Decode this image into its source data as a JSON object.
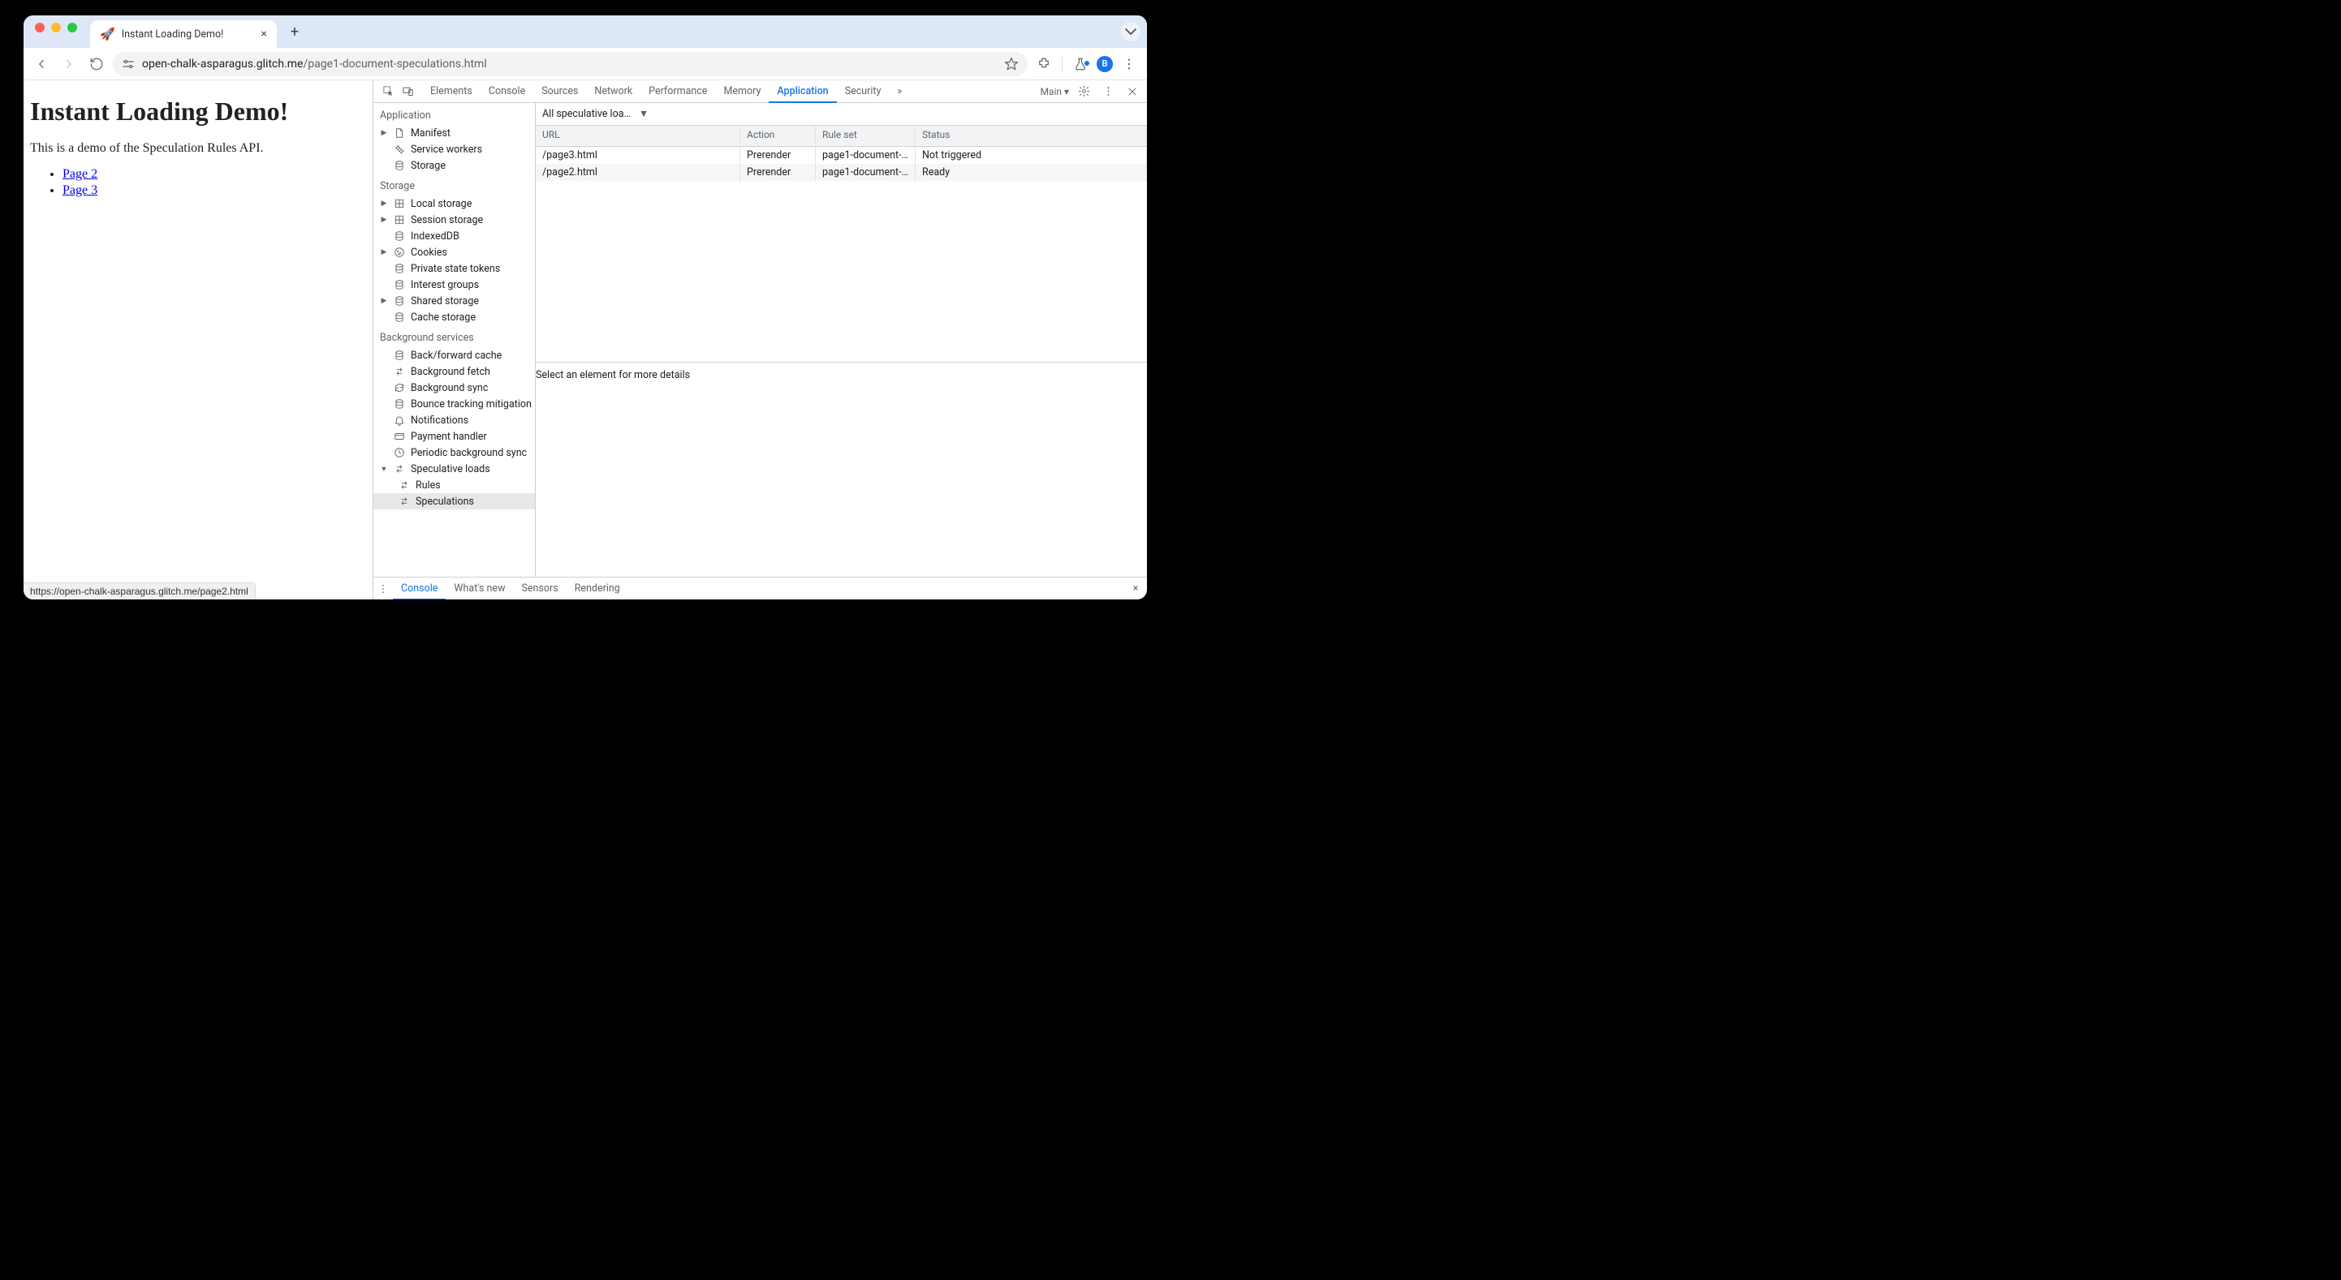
{
  "window": {
    "tab_title": "Instant Loading Demo!",
    "favicon": "🚀"
  },
  "toolbar": {
    "url_host": "open-chalk-asparagus.glitch.me",
    "url_path": "/page1-document-speculations.html",
    "avatar_letter": "B"
  },
  "page": {
    "heading": "Instant Loading Demo!",
    "intro": "This is a demo of the Speculation Rules API.",
    "links": [
      "Page 2",
      "Page 3"
    ],
    "status_url": "https://open-chalk-asparagus.glitch.me/page2.html"
  },
  "devtools": {
    "tabs": [
      "Elements",
      "Console",
      "Sources",
      "Network",
      "Performance",
      "Memory",
      "Application",
      "Security"
    ],
    "active_tab": "Application",
    "more": "»",
    "target_label": "Main",
    "sidebar": {
      "groups": [
        {
          "title": "Application",
          "items": [
            {
              "label": "Manifest",
              "icon": "file",
              "expandable": true
            },
            {
              "label": "Service workers",
              "icon": "gears"
            },
            {
              "label": "Storage",
              "icon": "db"
            }
          ]
        },
        {
          "title": "Storage",
          "items": [
            {
              "label": "Local storage",
              "icon": "grid",
              "expandable": true
            },
            {
              "label": "Session storage",
              "icon": "grid",
              "expandable": true
            },
            {
              "label": "IndexedDB",
              "icon": "db"
            },
            {
              "label": "Cookies",
              "icon": "cookie",
              "expandable": true
            },
            {
              "label": "Private state tokens",
              "icon": "db"
            },
            {
              "label": "Interest groups",
              "icon": "db"
            },
            {
              "label": "Shared storage",
              "icon": "db",
              "expandable": true
            },
            {
              "label": "Cache storage",
              "icon": "db"
            }
          ]
        },
        {
          "title": "Background services",
          "items": [
            {
              "label": "Back/forward cache",
              "icon": "db"
            },
            {
              "label": "Background fetch",
              "icon": "swap"
            },
            {
              "label": "Background sync",
              "icon": "sync"
            },
            {
              "label": "Bounce tracking mitigation",
              "icon": "db"
            },
            {
              "label": "Notifications",
              "icon": "bell"
            },
            {
              "label": "Payment handler",
              "icon": "card"
            },
            {
              "label": "Periodic background sync",
              "icon": "clock"
            },
            {
              "label": "Speculative loads",
              "icon": "swap",
              "expandable": true,
              "open": true,
              "children": [
                {
                  "label": "Rules",
                  "icon": "swap"
                },
                {
                  "label": "Speculations",
                  "icon": "swap",
                  "selected": true
                }
              ]
            }
          ]
        }
      ]
    },
    "filter_label": "All speculative loa…",
    "table": {
      "headers": [
        "URL",
        "Action",
        "Rule set",
        "Status"
      ],
      "rows": [
        {
          "url": "/page3.html",
          "action": "Prerender",
          "rule": "page1-document-…",
          "status": "Not triggered"
        },
        {
          "url": "/page2.html",
          "action": "Prerender",
          "rule": "page1-document-…",
          "status": "Ready"
        }
      ]
    },
    "detail_placeholder": "Select an element for more details",
    "drawer": {
      "tabs": [
        "Console",
        "What's new",
        "Sensors",
        "Rendering"
      ],
      "active": "Console"
    }
  }
}
